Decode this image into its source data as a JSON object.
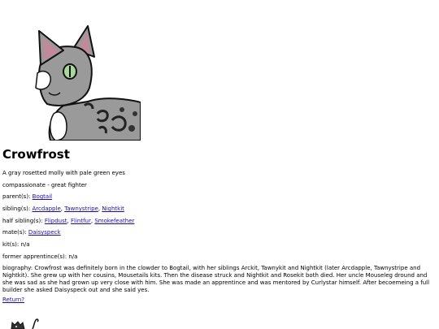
{
  "cat": {
    "name": "Crowfrost",
    "description": "A gray rosetted molly with pale green eyes",
    "traits": "compassionate - great fighter",
    "parents": {
      "label": "parent(s):",
      "links": [
        "Bogtail"
      ]
    },
    "siblings": {
      "label": "sibling(s):",
      "links": [
        "Arcdapple",
        "Tawnystripe",
        "Nightkit"
      ]
    },
    "half_siblings": {
      "label": "half sibling(s):",
      "links": [
        "Flipdust",
        "Flintfur",
        "Smokefeather"
      ]
    },
    "mates": {
      "label": "mate(s):",
      "links": [
        "Daisyspeck"
      ]
    },
    "kits": {
      "label": "kit(s):",
      "value": "n/a"
    },
    "former_apprentices": {
      "label": "former apprentince(s):",
      "value": "n/a"
    },
    "biography": "biography: Crowfrost was definitely born in the clowder to Bogtail, with her siblings Arckit, Tawnykit and Nightkit (later Arcdapple, Tawnystripe and Nightkit). She grew up with her cousins, Mousetails kits. Then the disease struck and Nightkit and Rosekit both died. Her uncle Mouseleg dround and she was sad as she had grown up very close with him. She was made an apprentince and was mentored by Curlystar himself. After becoemeing a full builder she asked Daisyspeck out and she said yes."
  },
  "return_link": "Return?",
  "colors": {
    "link": "#1a0dab",
    "fur": "#9a9a9a",
    "ear_inner": "#c08a9a",
    "eye": "#a8d89a"
  }
}
